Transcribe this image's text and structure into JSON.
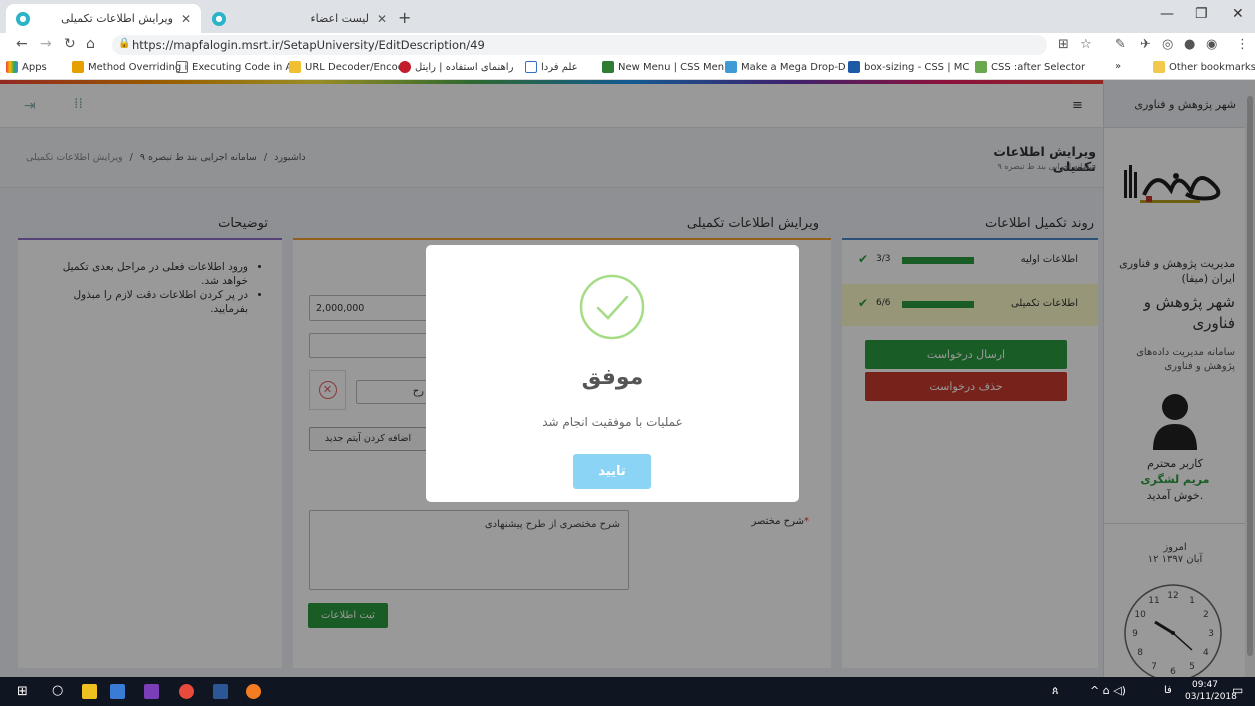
{
  "browser": {
    "tabs": [
      {
        "title": "ویرایش اطلاعات تکمیلی",
        "active": true
      },
      {
        "title": "لیست اعضاء",
        "active": false
      }
    ],
    "url": "https://mapfalogin.msrt.ir/SetapUniversity/EditDescription/49",
    "bookmarks": [
      "Apps",
      "Method Overriding i",
      "Executing Code in Ac",
      "URL Decoder/Encode",
      "راهنمای استفاده | رایتل",
      "علم فردا",
      "New Menu | CSS Men",
      "Make a Mega Drop-D",
      "box-sizing - CSS | MC",
      "CSS :after Selector"
    ],
    "more_bookmarks": "»",
    "other_bookmarks": "Other bookmarks"
  },
  "sidebar": {
    "site_title": "شهر پژوهش و فناوری",
    "org_name": "مدیریت پژوهش و فناوری ایران (میفا)",
    "city_title": "شهر پژوهش و فناوری",
    "system_name": "سامانه مدیریت داده‌های پژوهش و فناوری",
    "greeting_prefix": "کاربر محترم",
    "user_name": "مریم لشگری",
    "greeting_suffix": "خوش آمدید.",
    "today_label": "امروز",
    "today_date": "۱۲ آبان ۱۳۹۷",
    "clock_numbers": [
      "12",
      "1",
      "2",
      "3",
      "4",
      "5",
      "6",
      "7",
      "8",
      "9",
      "10",
      "11"
    ]
  },
  "page": {
    "title": "ویرایش اطلاعات تکمیلی",
    "subtitle": "سامانه اجرایی بند ط تبصره ۹",
    "breadcrumb": [
      "داشبورد",
      "سامانه اجرایی بند ط تبصره ۹",
      "ویرایش اطلاعات تکمیلی"
    ],
    "breadcrumb_sep": "/"
  },
  "progress_panel": {
    "title": "روند تکمیل اطلاعات",
    "rows": [
      {
        "label": "اطلاعات اولیه",
        "count": "3/3",
        "progress": 1.0
      },
      {
        "label": "اطلاعات تکمیلی",
        "count": "6/6",
        "progress": 1.0
      }
    ],
    "send_button": "ارسال درخواست",
    "delete_button": "حذف درخواست"
  },
  "form_panel": {
    "title": "ویرایش اطلاعات تکمیلی",
    "amount_value": "2,000,000",
    "item_input_partial": "رح",
    "add_item_button": "اضافه کردن آیتم جدید",
    "summary_label": "شرح مختصر",
    "required_mark": "*",
    "summary_placeholder": "شرح مختصری از طرح پیشنهادی",
    "submit_button": "ثبت اطلاعات"
  },
  "notes_panel": {
    "title": "توضیحات",
    "items": [
      "ورود اطلاعات فعلی در مراحل بعدی تکمیل خواهد شد.",
      "در پر کردن اطلاعات دقت لازم را مبذول بفرمایید."
    ]
  },
  "modal": {
    "title": "موفق",
    "message": "عملیات با موفقیت انجام شد",
    "confirm_button": "تایید"
  },
  "taskbar": {
    "time": "09:47",
    "date": "03/11/2018",
    "lang": "فا"
  },
  "colors": {
    "green": "#2a9a3e",
    "red": "#c8392f",
    "modal_check": "#a5dc86",
    "confirm_button": "#8cd4f5",
    "accent_orange": "#f0a030",
    "accent_purple": "#8e6fc8",
    "accent_blue": "#4a86c8"
  }
}
